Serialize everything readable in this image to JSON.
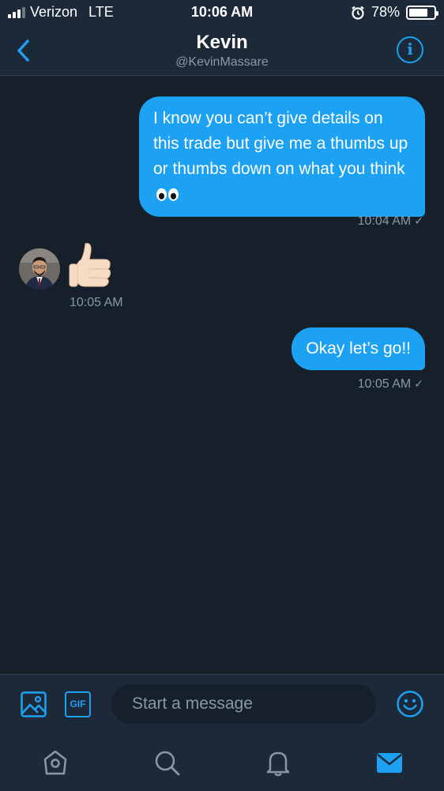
{
  "status_bar": {
    "carrier": "Verizon",
    "network": "LTE",
    "time": "10:06 AM",
    "battery": "78%",
    "battery_level": 0.78
  },
  "header": {
    "name": "Kevin",
    "handle": "@KevinMassare",
    "icons": {
      "back": "chevron-left-icon",
      "info": "info-icon"
    }
  },
  "messages": [
    {
      "direction": "outgoing",
      "text": "I know you can’t give details on this trade but give me a thumbs up or thumbs down on what you think",
      "emoji": "eyes",
      "time": "10:04 AM"
    },
    {
      "direction": "incoming",
      "emoji": "thumbs-up",
      "time": "10:05 AM"
    },
    {
      "direction": "outgoing",
      "text": "Okay let’s go!!",
      "time": "10:05 AM"
    }
  ],
  "composer": {
    "gif_label": "GIF",
    "placeholder": "Start a message"
  },
  "tab_bar": {
    "items": [
      "home-icon",
      "search-icon",
      "notifications-icon",
      "messages-icon"
    ],
    "active": "messages-icon"
  },
  "colors": {
    "accent": "#1da1f2",
    "background": "#15202b",
    "bar": "#1c2938",
    "muted": "#8899a6"
  }
}
